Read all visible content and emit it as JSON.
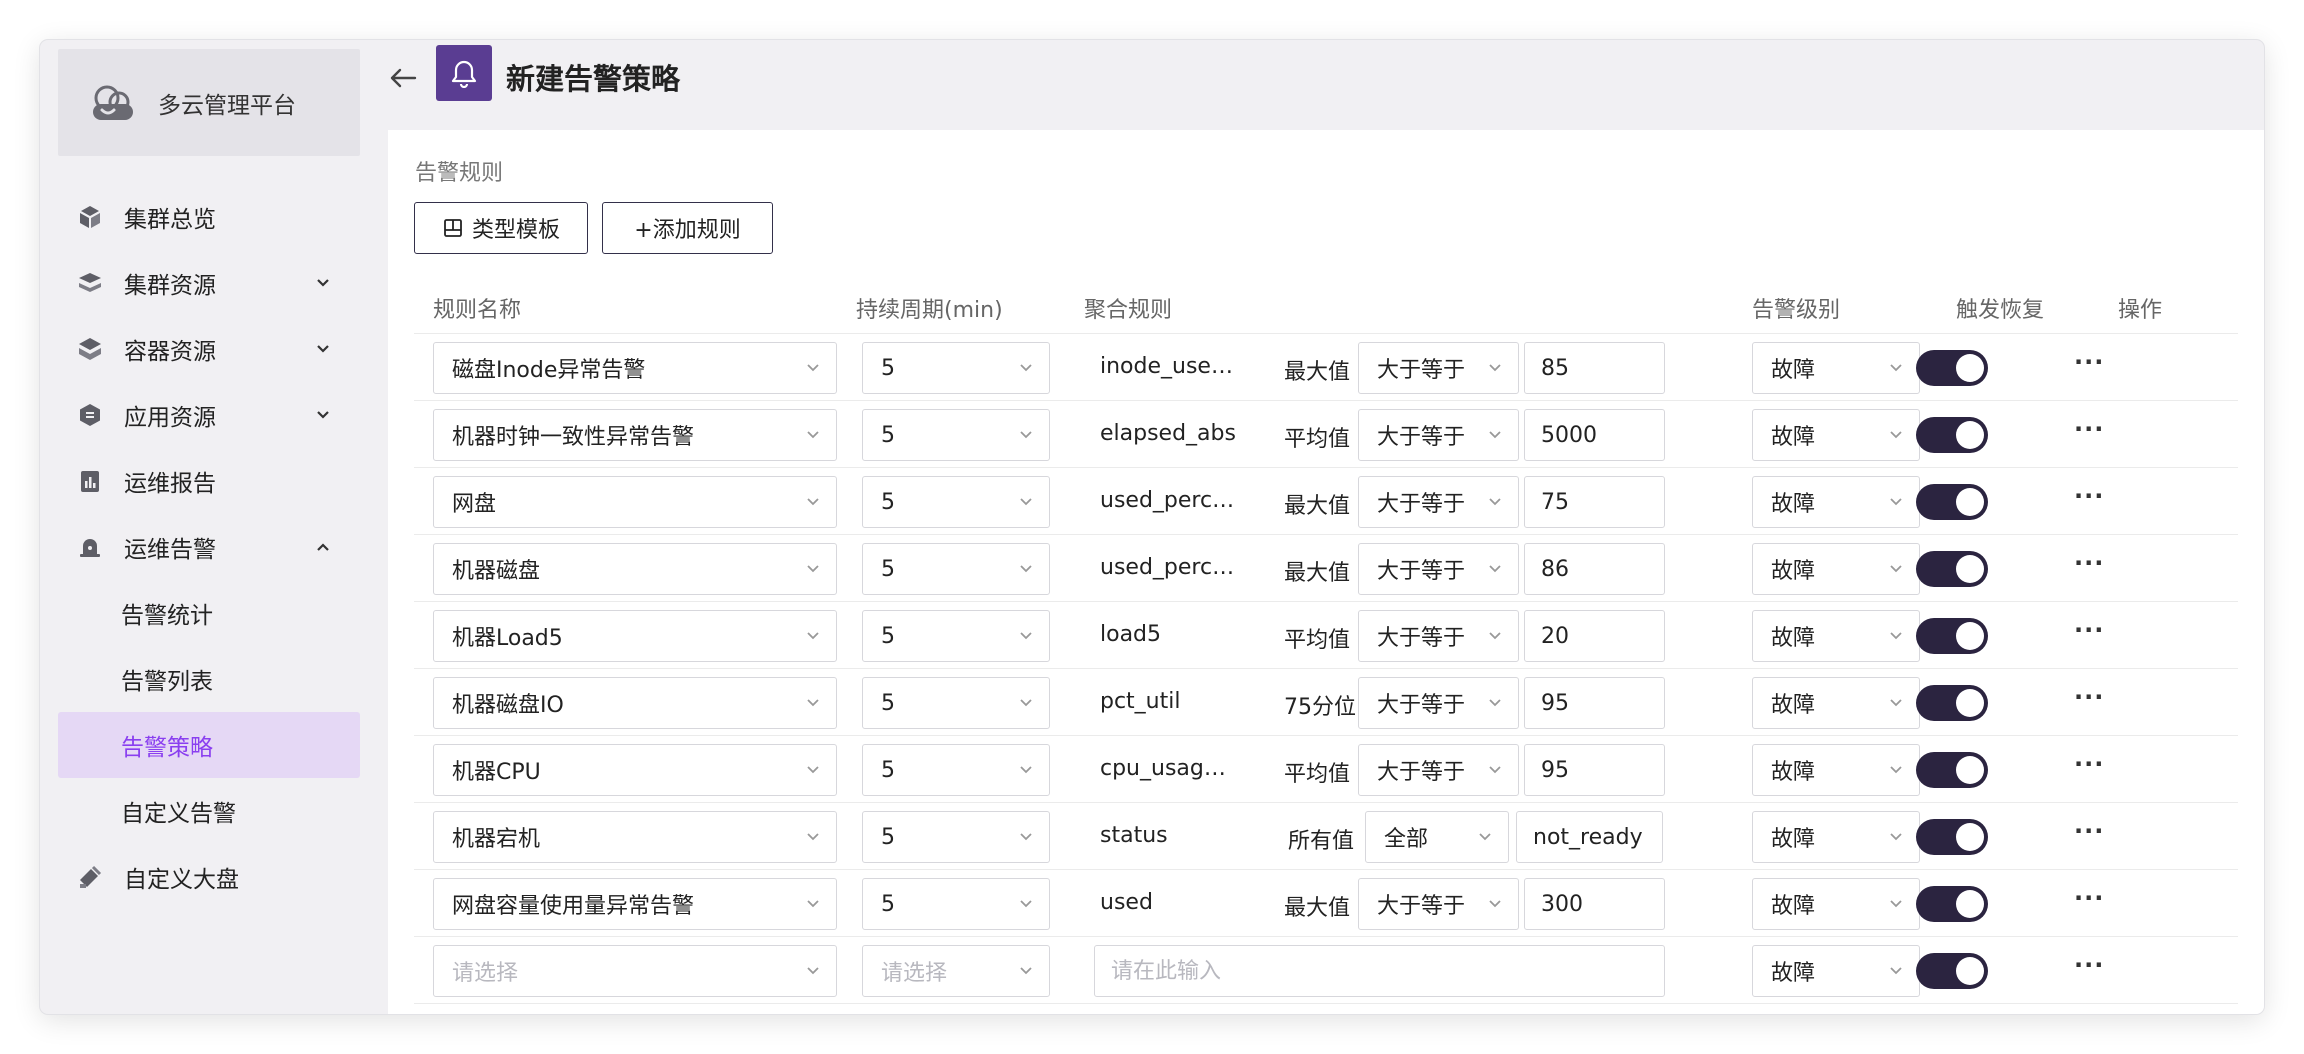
{
  "app": {
    "name": "多云管理平台"
  },
  "sidebar": {
    "items": [
      {
        "label": "集群总览"
      },
      {
        "label": "集群资源"
      },
      {
        "label": "容器资源"
      },
      {
        "label": "应用资源"
      },
      {
        "label": "运维报告"
      },
      {
        "label": "运维告警"
      },
      {
        "label": "告警统计"
      },
      {
        "label": "告警列表"
      },
      {
        "label": "告警策略"
      },
      {
        "label": "自定义告警"
      },
      {
        "label": "自定义大盘"
      }
    ]
  },
  "header": {
    "title": "新建告警策略"
  },
  "section": {
    "title": "告警规则"
  },
  "toolbar": {
    "template_label": "类型模板",
    "add_label": "+添加规则"
  },
  "table": {
    "headers": {
      "name": "规则名称",
      "period": "持续周期(min)",
      "agg": "聚合规则",
      "level": "告警级别",
      "recover": "触发恢复",
      "ops": "操作"
    },
    "rows": [
      {
        "name": "磁盘Inode异常告警",
        "period": "5",
        "metric": "inode_used...",
        "func": "最大值",
        "op": "大于等于",
        "threshold": "85",
        "level": "故障"
      },
      {
        "name": "机器时钟一致性异常告警",
        "period": "5",
        "metric": "elapsed_abs",
        "func": "平均值",
        "op": "大于等于",
        "threshold": "5000",
        "level": "故障"
      },
      {
        "name": "网盘",
        "period": "5",
        "metric": "used_percent",
        "func": "最大值",
        "op": "大于等于",
        "threshold": "75",
        "level": "故障"
      },
      {
        "name": "机器磁盘",
        "period": "5",
        "metric": "used_percent",
        "func": "最大值",
        "op": "大于等于",
        "threshold": "86",
        "level": "故障"
      },
      {
        "name": "机器Load5",
        "period": "5",
        "metric": "load5",
        "func": "平均值",
        "op": "大于等于",
        "threshold": "20",
        "level": "故障"
      },
      {
        "name": "机器磁盘IO",
        "period": "5",
        "metric": "pct_util",
        "func": "75分位",
        "op": "大于等于",
        "threshold": "95",
        "level": "故障"
      },
      {
        "name": "机器CPU",
        "period": "5",
        "metric": "cpu_usage_...",
        "func": "平均值",
        "op": "大于等于",
        "threshold": "95",
        "level": "故障"
      },
      {
        "name": "机器宕机",
        "period": "5",
        "metric": "status",
        "func": "所有值",
        "op": "全部",
        "threshold": "not_ready",
        "level": "故障"
      },
      {
        "name": "网盘容量使用量异常告警",
        "period": "5",
        "metric": "used",
        "func": "最大值",
        "op": "大于等于",
        "threshold": "300",
        "level": "故障"
      }
    ],
    "new_row": {
      "name_placeholder": "请选择",
      "period_placeholder": "请选择",
      "agg_placeholder": "请在此输入",
      "level": "故障"
    },
    "more_label": "···"
  },
  "colors": {
    "accent": "#8a3ff0",
    "accent_bg": "#e5d8f5",
    "brand": "#5a3d92",
    "toggle": "#2b2440"
  }
}
